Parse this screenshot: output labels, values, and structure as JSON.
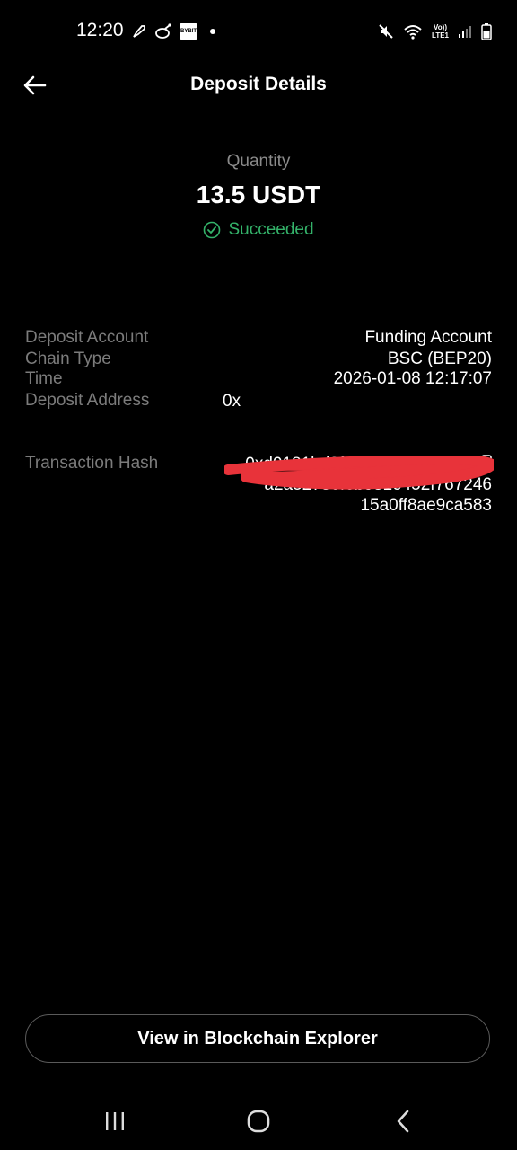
{
  "status_bar": {
    "time": "12:20",
    "left_icons": [
      "rocket-icon",
      "satellite-icon",
      "bybit-app-icon",
      "notification-dot"
    ],
    "bybit_badge_text": "BYBIT",
    "right_icons": [
      "mute-icon",
      "wifi-icon",
      "volte-icon",
      "signal-icon",
      "battery-icon"
    ],
    "volte_line1": "Vo))",
    "volte_line2": "LTE1"
  },
  "header": {
    "title": "Deposit Details"
  },
  "summary": {
    "quantity_label": "Quantity",
    "quantity_value": "13.5 USDT",
    "status": "Succeeded",
    "status_color": "#34b36a"
  },
  "details": {
    "deposit_account": {
      "label": "Deposit Account",
      "value": "Funding Account"
    },
    "chain_type": {
      "label": "Chain Type",
      "value": "BSC (BEP20)"
    },
    "time": {
      "label": "Time",
      "value": "2026-01-08 12:17:07"
    },
    "deposit_address": {
      "label": "Deposit Address",
      "line1": "0x",
      "line2": ""
    },
    "transaction_hash": {
      "label": "Transaction Hash",
      "lines": [
        "0xd0181bd0faa6272a261c1f9f",
        "a2a52736f6b9316452f767246",
        "15a0ff8ae9ca583"
      ]
    }
  },
  "explorer_button": {
    "label": "View in Blockchain Explorer"
  },
  "nav_bar": {
    "buttons": [
      "recents-button",
      "home-button",
      "back-nav-button"
    ]
  },
  "colors": {
    "background": "#000000",
    "label_gray": "#7b7b7b",
    "success_green": "#34b36a",
    "redaction_red": "#e8333a"
  }
}
